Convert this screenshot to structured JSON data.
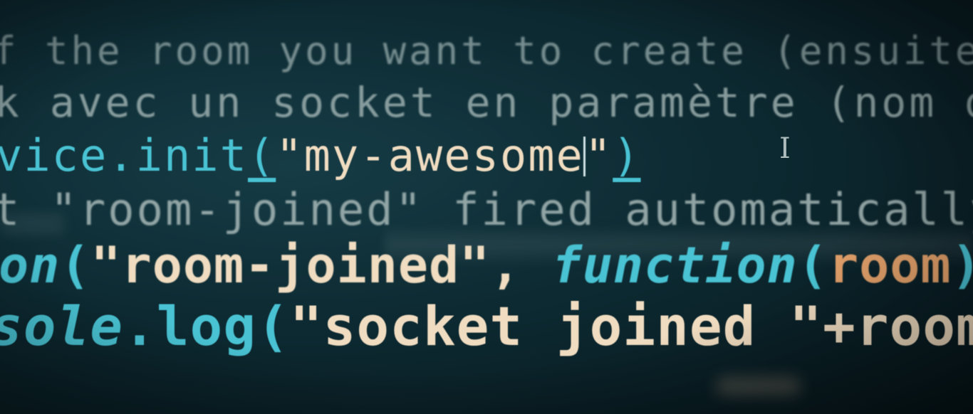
{
  "code_lines": {
    "line1": "f the room you want to create (ensuite",
    "line2": "k avec un socket en paramètre (nom du",
    "line3": {
      "obj": "vice.init",
      "open": "(",
      "str_a": "\"my-awesome",
      "str_b": "\"",
      "close": ")"
    },
    "line4": "t \"room-joined\" fired automatically",
    "line5": {
      "fn": "on",
      "open": "(",
      "str": "\"room-joined\"",
      "comma": ", ",
      "kw": "function",
      "p_open": "(",
      "param": "room",
      "p_close": ") {"
    },
    "line6": {
      "obj": "sole",
      "dot": ".",
      "fn": "log",
      "open": "(",
      "str": "\"socket joined \"",
      "plus": "+",
      "var": "room",
      "close": ");"
    }
  },
  "cursor_icon": "text-cursor-ibeam-icon",
  "colors": {
    "keyword": "#49c3d3",
    "string": "#f0dcc0",
    "parameter": "#e2a06a",
    "comment": "#a8b9b8",
    "background": "#0d2a32"
  }
}
